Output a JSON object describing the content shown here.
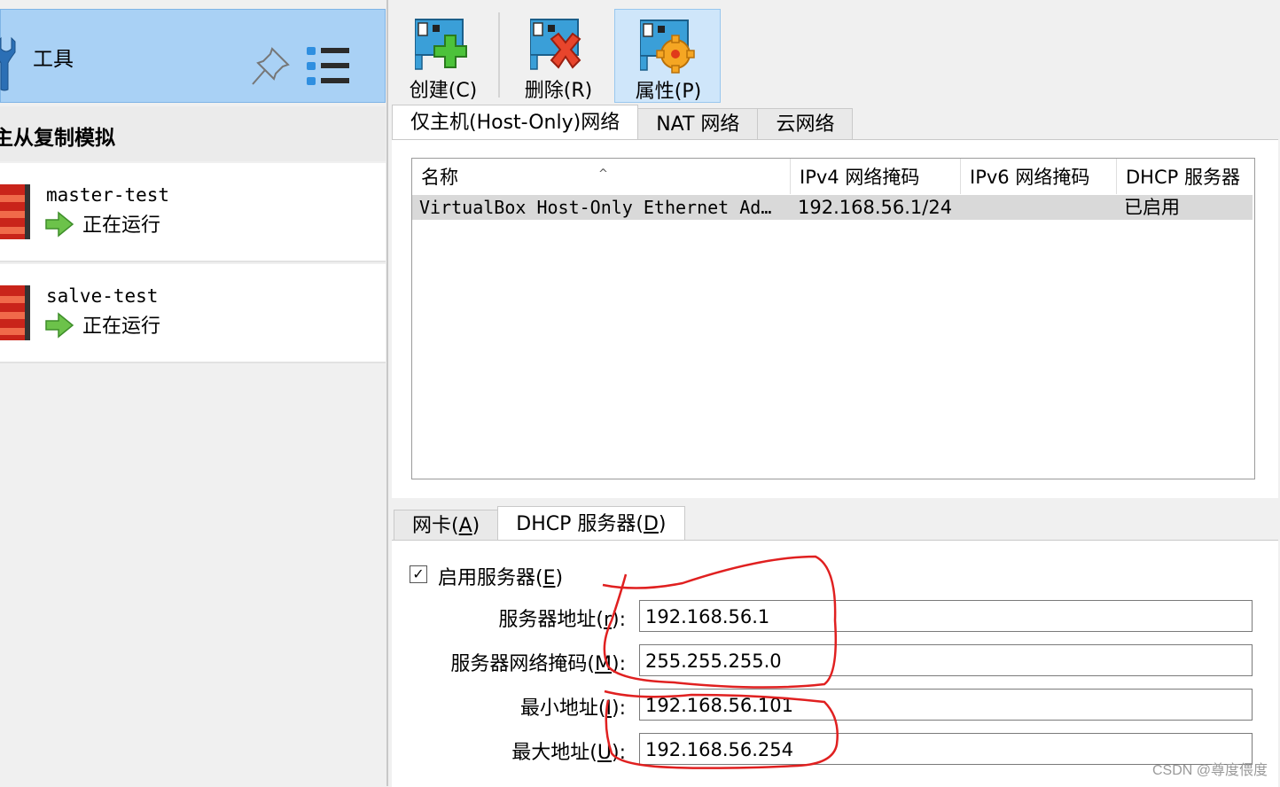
{
  "sidebar": {
    "tools_label": "工具",
    "group_title": "主从复制模拟",
    "vms": [
      {
        "name": "master-test",
        "status": "正在运行"
      },
      {
        "name": "salve-test",
        "status": "正在运行"
      }
    ]
  },
  "toolbar": {
    "create_label": "创建(C)",
    "delete_label": "删除(R)",
    "properties_label": "属性(P)"
  },
  "network_tabs": [
    {
      "label": "仅主机(Host-Only)网络",
      "active": true
    },
    {
      "label": "NAT 网络",
      "active": false
    },
    {
      "label": "云网络",
      "active": false
    }
  ],
  "table": {
    "headers": [
      "名称",
      "IPv4 网络掩码",
      "IPv6 网络掩码",
      "DHCP 服务器"
    ],
    "rows": [
      {
        "name": "VirtualBox Host-Only Ethernet Ad…",
        "ipv4": "192.168.56.1/24",
        "ipv6": "",
        "dhcp": "已启用"
      }
    ]
  },
  "detail_tabs": {
    "adapter": {
      "pre": "网卡(",
      "key": "A",
      "post": ")"
    },
    "dhcp": {
      "pre": "DHCP 服务器(",
      "key": "D",
      "post": ")"
    }
  },
  "dhcp_form": {
    "enable": {
      "pre": "启用服务器(",
      "key": "E",
      "post": ")",
      "checked": true
    },
    "server_address": {
      "pre": "服务器地址(",
      "key": "r",
      "post": "):",
      "value": "192.168.56.1"
    },
    "server_mask": {
      "pre": "服务器网络掩码(",
      "key": "M",
      "post": "):",
      "value": "255.255.255.0"
    },
    "lower_address": {
      "pre": "最小地址(",
      "key": "I",
      "post": "):",
      "value": "192.168.56.101"
    },
    "upper_address": {
      "pre": "最大地址(",
      "key": "U",
      "post": "):",
      "value": "192.168.56.254"
    }
  },
  "watermark": "CSDN @尊度偎度",
  "colors": {
    "tools_bg": "#a9d1f5",
    "selected_button_bg": "#cfe6fa",
    "annotation_red": "#e02020"
  }
}
